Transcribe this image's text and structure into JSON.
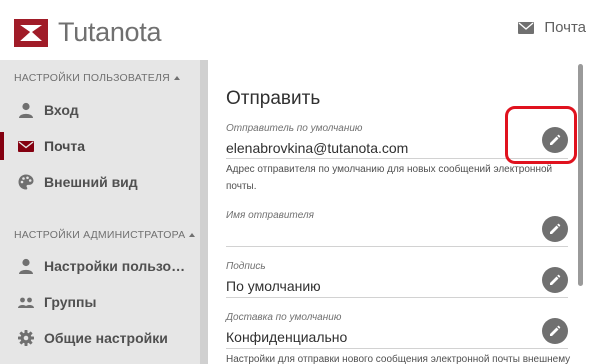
{
  "header": {
    "logo_text_a": "Tuta",
    "logo_text_b": "nota",
    "mail_nav_label": "Почта"
  },
  "sidebar": {
    "user_settings_title": "НАСТРОЙКИ ПОЛЬЗОВАТЕЛЯ",
    "admin_settings_title": "НАСТРОЙКИ АДМИНИСТРАТОРА",
    "user_items": [
      {
        "label": "Вход",
        "icon": "person-icon"
      },
      {
        "label": "Почта",
        "icon": "mail-icon",
        "active": true
      },
      {
        "label": "Внешний вид",
        "icon": "palette-icon"
      }
    ],
    "admin_items": [
      {
        "label": "Настройки пользователя",
        "icon": "person-icon"
      },
      {
        "label": "Группы",
        "icon": "group-icon"
      },
      {
        "label": "Общие настройки",
        "icon": "gear-icon"
      }
    ]
  },
  "main": {
    "title": "Отправить",
    "fields": [
      {
        "label": "Отправитель по умолчанию",
        "value": "elenabrovkina@tutanota.com",
        "help": "Адрес отправителя по умолчанию для новых сообщений электронной почты."
      },
      {
        "label": "Имя отправителя",
        "value": ""
      },
      {
        "label": "Подпись",
        "value": "По умолчанию"
      },
      {
        "label": "Доставка по умолчанию",
        "value": "Конфиденциально",
        "help": "Настройки для отправки нового сообщения электронной почты внешнему"
      }
    ]
  },
  "colors": {
    "accent": "#840010",
    "highlight": "#e0121e",
    "sidebar_bg": "#e6e6e6",
    "button_bg": "#707070"
  }
}
